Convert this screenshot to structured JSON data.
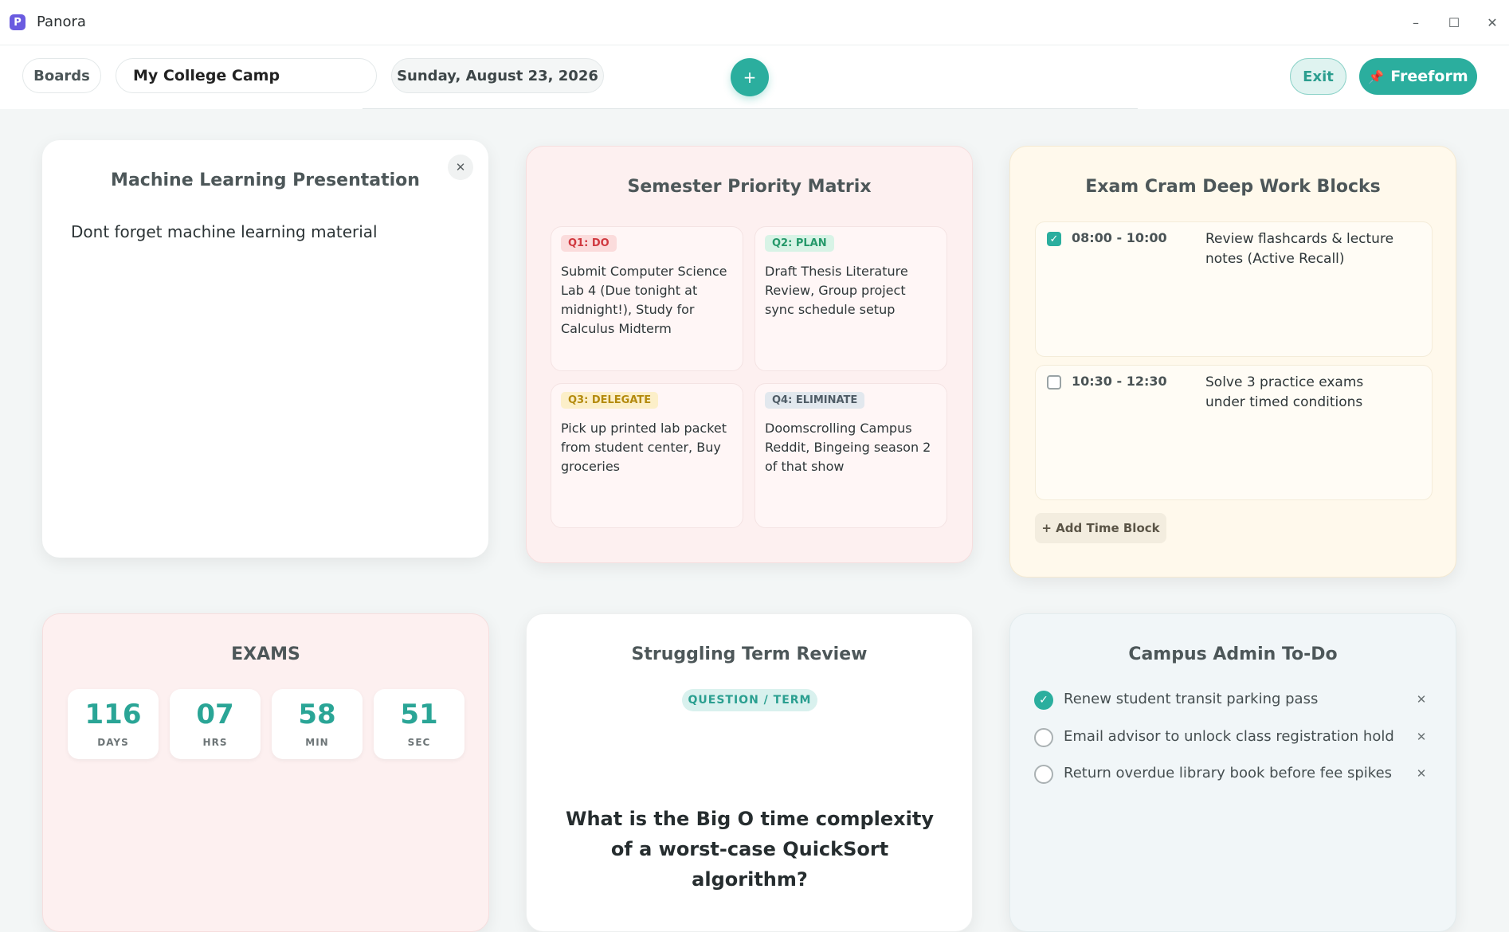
{
  "window": {
    "app_title": "Panora",
    "logo_letter": "P",
    "minimize": "–",
    "maximize": "☐",
    "close": "✕"
  },
  "toolbar": {
    "boards_label": "Boards",
    "board_name": "My College Camp",
    "date": "Sunday, August 23, 2026",
    "add_label": "+",
    "exit_label": "Exit",
    "freeform_label": "Freeform"
  },
  "note_card": {
    "title": "Machine Learning Presentation",
    "close": "✕",
    "body": "Dont forget machine learning material"
  },
  "matrix_card": {
    "title": "Semester Priority Matrix",
    "quadrants": [
      {
        "tag": "Q1: DO",
        "text": "Submit Computer Science Lab 4 (Due tonight at midnight!), Study for Calculus Midterm",
        "tag_bg": "#fbdcdc",
        "tag_color": "#d0383f"
      },
      {
        "tag": "Q2: PLAN",
        "text": "Draft Thesis Literature Review, Group project sync schedule setup",
        "tag_bg": "#d8f3e6",
        "tag_color": "#25996a"
      },
      {
        "tag": "Q3: DELEGATE",
        "text": "Pick up printed lab packet from student center, Buy groceries",
        "tag_bg": "#fcefc9",
        "tag_color": "#b48a0d"
      },
      {
        "tag": "Q4: ELIMINATE",
        "text": "Doomscrolling Campus Reddit, Bingeing season 2 of that show",
        "tag_bg": "#e2e8ee",
        "tag_color": "#4f5c66"
      }
    ]
  },
  "exam_card": {
    "title": "Exam Cram Deep Work Blocks",
    "blocks": [
      {
        "checked": true,
        "check": "✓",
        "time": "08:00 - 10:00",
        "task": "Review flashcards & lecture notes (Active Recall)"
      },
      {
        "checked": false,
        "check": "",
        "time": "10:30 - 12:30",
        "task": "Solve 3 practice exams under timed conditions"
      }
    ],
    "add_label": "+ Add Time Block"
  },
  "exams_card": {
    "title": "EXAMS",
    "countdown": [
      {
        "value": "116",
        "label": "DAYS"
      },
      {
        "value": "07",
        "label": "HRS"
      },
      {
        "value": "58",
        "label": "MIN"
      },
      {
        "value": "51",
        "label": "SEC"
      }
    ]
  },
  "review_card": {
    "title": "Struggling Term Review",
    "badge": "QUESTION / TERM",
    "question": "What is the Big O time complexity of a worst-case QuickSort algorithm?"
  },
  "admin_card": {
    "title": "Campus Admin To-Do",
    "items": [
      {
        "done": true,
        "mark": "✓",
        "text": "Renew student transit parking pass",
        "remove": "✕"
      },
      {
        "done": false,
        "mark": "",
        "text": "Email advisor to unlock class registration hold",
        "remove": "✕"
      },
      {
        "done": false,
        "mark": "",
        "text": "Return overdue library book before fee spikes",
        "remove": "✕"
      }
    ]
  },
  "colors": {
    "accent": "#2bae9e",
    "logo": "#6a5be0",
    "pin": "#ea3d5a"
  }
}
